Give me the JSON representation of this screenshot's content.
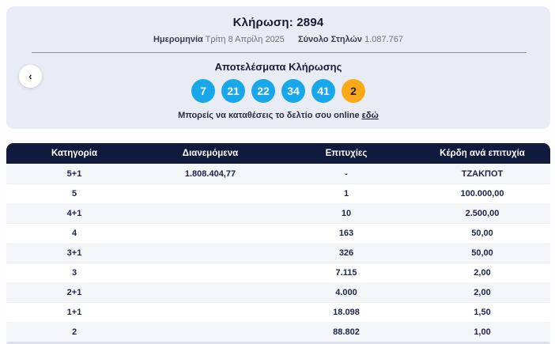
{
  "banner": {
    "title": "Κλήρωση: 2894",
    "date_label": "Ημερομηνία",
    "date_value": "Τρίτη 8 Απρίλη 2025",
    "columns_label": "Σύνολο Στηλών",
    "columns_value": "1.087.767",
    "results_heading": "Αποτελέσματα Κλήρωσης",
    "numbers": [
      "7",
      "21",
      "22",
      "34",
      "41"
    ],
    "joker_number": "2",
    "deposit_text": "Μπορείς να καταθέσεις το δελτίο σου online ",
    "deposit_link_label": "εδώ",
    "prev_button_glyph": "‹"
  },
  "colors": {
    "banner_bg": "#e9ecf4",
    "ball_blue": "#18a7e9",
    "ball_orange": "#fba919",
    "table_header_navy": "#0f1a3d",
    "row_alt_bg": "#f4f5f8"
  },
  "table": {
    "headers": [
      "Κατηγορία",
      "Διανεμόμενα",
      "Επιτυχίες",
      "Κέρδη ανά επιτυχία"
    ],
    "rows": [
      {
        "category": "5+1",
        "distributed": "1.808.404,77",
        "winners": "-",
        "prize": "ΤΖΑΚΠΟΤ"
      },
      {
        "category": "5",
        "distributed": "",
        "winners": "1",
        "prize": "100.000,00"
      },
      {
        "category": "4+1",
        "distributed": "",
        "winners": "10",
        "prize": "2.500,00"
      },
      {
        "category": "4",
        "distributed": "",
        "winners": "163",
        "prize": "50,00"
      },
      {
        "category": "3+1",
        "distributed": "",
        "winners": "326",
        "prize": "50,00"
      },
      {
        "category": "3",
        "distributed": "",
        "winners": "7.115",
        "prize": "2,00"
      },
      {
        "category": "2+1",
        "distributed": "",
        "winners": "4.000",
        "prize": "2,00"
      },
      {
        "category": "1+1",
        "distributed": "",
        "winners": "18.098",
        "prize": "1,50"
      },
      {
        "category": "2",
        "distributed": "",
        "winners": "88.802",
        "prize": "1,00"
      }
    ]
  }
}
